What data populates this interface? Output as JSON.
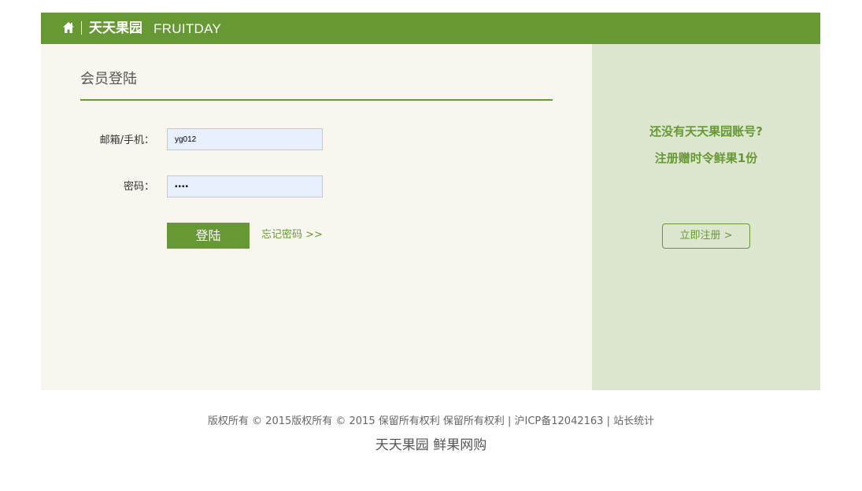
{
  "header": {
    "icon": "home-icon",
    "brand_cn": "天天果园",
    "brand_en": "FRUITDAY",
    "bg_color": "#669933"
  },
  "login": {
    "title": "会员登陆",
    "account_label": "邮箱/手机：",
    "account_value": "yg012",
    "password_label": "密码：",
    "password_value": "••••",
    "submit_label": "登陆",
    "forgot_label": "忘记密码 >>"
  },
  "promo": {
    "line1": "还没有天天果园账号?",
    "line2": "注册赠时令鲜果1份",
    "register_label": "立即注册 >"
  },
  "footer": {
    "copyright": "版权所有 © 2015版权所有 © 2015 保留所有权利 保留所有权利 | 沪ICP备12042163 | 站长统计",
    "tagline": "天天果园 鲜果网购"
  },
  "colors": {
    "accent": "#669933",
    "left_bg": "#f9f6f0",
    "right_bg": "#dde6cf",
    "input_bg": "#e8f0fe"
  }
}
